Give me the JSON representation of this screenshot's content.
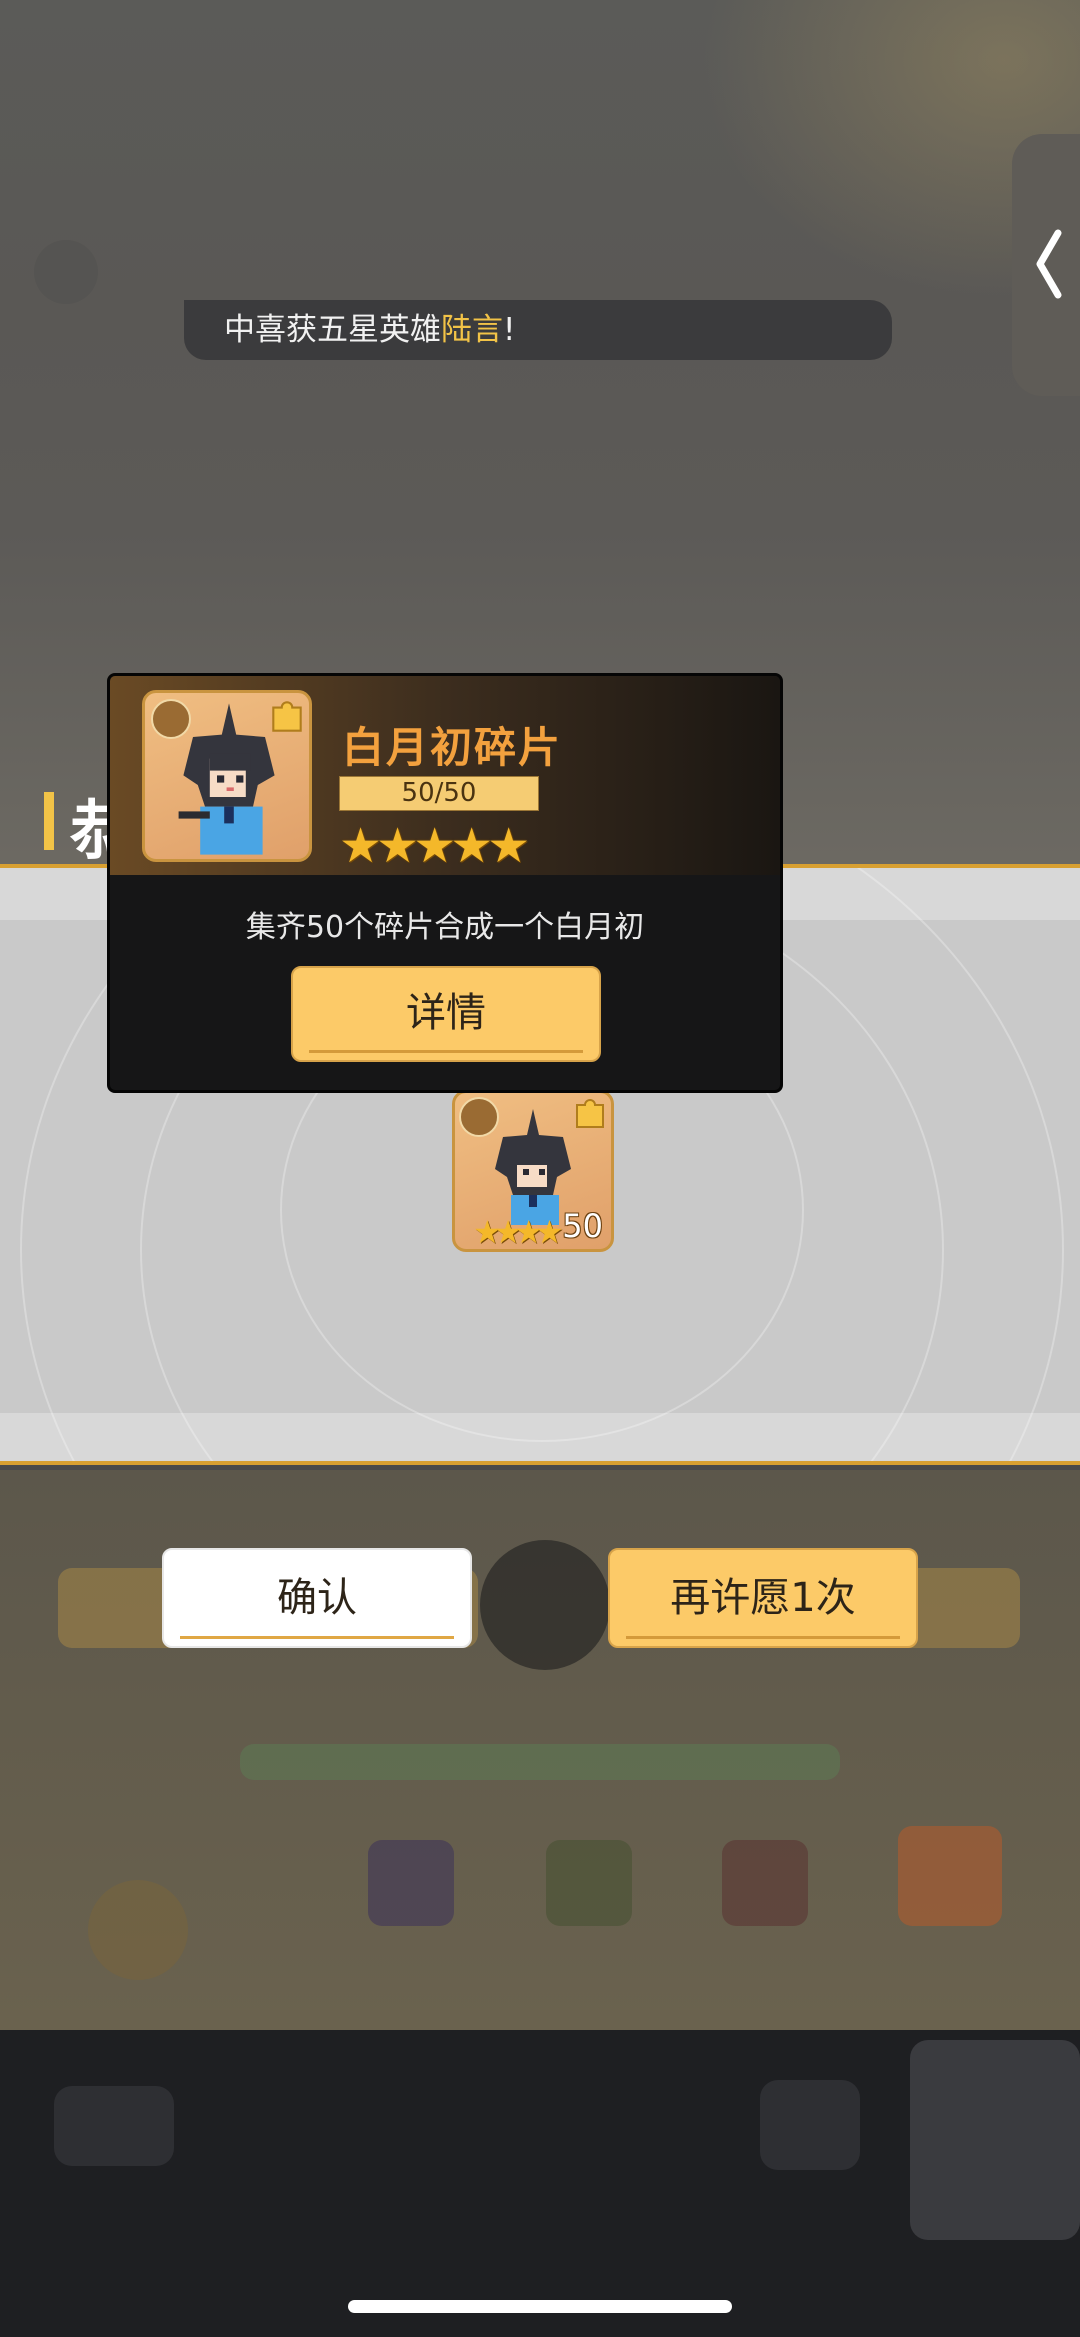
{
  "toast": {
    "prefix": "中喜获五星英雄",
    "hero_name": "陆言",
    "suffix": "!"
  },
  "section": {
    "title_fragment": "恭"
  },
  "popup": {
    "item_name": "白月初碎片",
    "progress_text": "50/50",
    "progress_value": 1.0,
    "stars": 5,
    "description": "集齐50个碎片合成一个白月初",
    "details_button": "详情"
  },
  "reward": {
    "count": "50",
    "stars": 4
  },
  "actions": {
    "confirm": "确认",
    "wish_again": "再许愿1次"
  },
  "colors": {
    "accent_yellow": "#fcca68",
    "highlight_gold": "#f2c347",
    "title_orange": "#f3a13e",
    "star_gold": "#f4b82a"
  },
  "icons": [
    "chevron-left-icon",
    "lotus-badge-icon",
    "puzzle-piece-icon",
    "star-icon"
  ]
}
